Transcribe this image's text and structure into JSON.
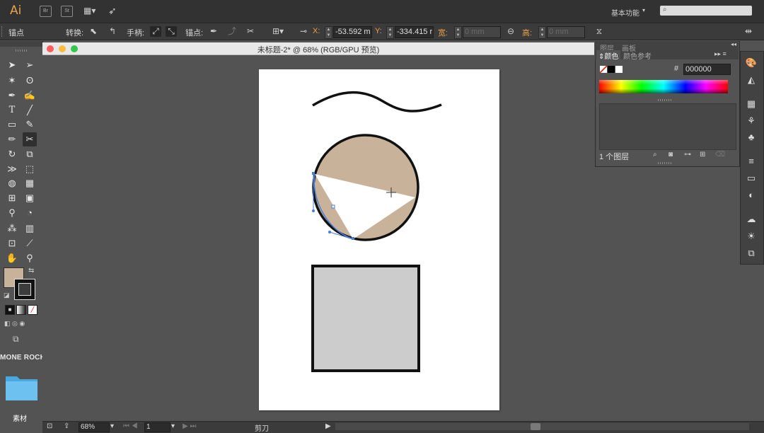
{
  "app": {
    "logo": "Ai",
    "bridge_btn": "Br",
    "stock_btn": "St",
    "workspace": "基本功能",
    "search_placeholder": ""
  },
  "control_bar": {
    "anchor_label": "锚点",
    "convert_label": "转换:",
    "handles_label": "手柄:",
    "anchors_label": "锚点:",
    "x_label": "X:",
    "x_value": "-53.592 m",
    "y_label": "Y:",
    "y_value": "-334.415 r",
    "w_label": "宽:",
    "w_value": "0 mm",
    "h_label": "高:",
    "h_value": "0 mm"
  },
  "document": {
    "title": "未标题-2* @ 68% (RGB/GPU 预览)",
    "fill_color": "#c8b39a",
    "rect_fill": "#cccccc"
  },
  "status_bar": {
    "zoom": "68%",
    "page": "1",
    "tool": "剪刀"
  },
  "desktop": {
    "label": "MONE ROCH",
    "folder_label": "素材"
  },
  "color_panel": {
    "tab_color": "颜色",
    "tab_guide": "颜色参考",
    "tab_layers_hidden": "图层",
    "tab_artboard_hidden": "画板",
    "hex_label": "#",
    "hex_value": "000000"
  },
  "layers_panel": {
    "count": "1 个图层"
  }
}
